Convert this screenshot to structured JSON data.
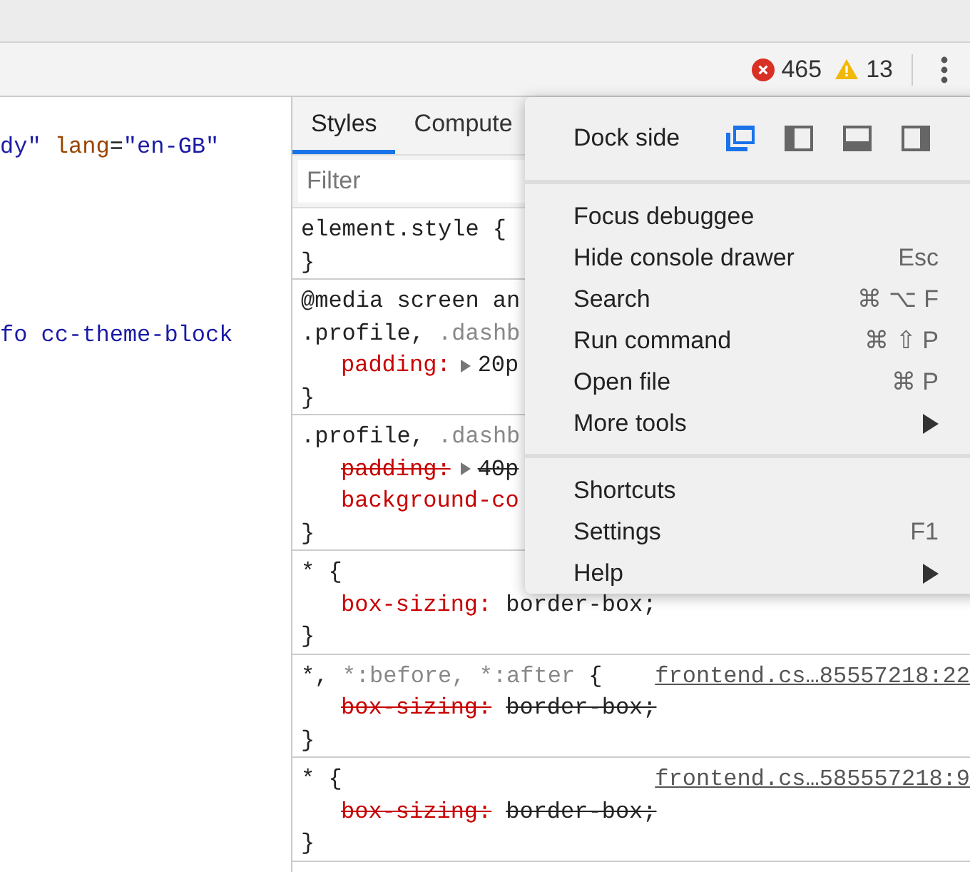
{
  "toolbar": {
    "errors": "465",
    "warnings": "13"
  },
  "elements": {
    "lines": [
      {
        "tokens": [
          {
            "kind": "value",
            "text": "dy\""
          },
          {
            "kind": "name",
            "text": "lang"
          },
          {
            "kind": "punct",
            "text": "="
          },
          {
            "kind": "value",
            "text": "\"en-GB\""
          }
        ]
      },
      {
        "tokens": [
          {
            "kind": "value",
            "text": "fo cc-theme-block"
          }
        ]
      }
    ]
  },
  "styles": {
    "tabs": [
      {
        "label": "Styles",
        "selected": true
      },
      {
        "label": "Compute",
        "selected": false
      }
    ],
    "filter": {
      "placeholder": "Filter"
    },
    "rules": [
      {
        "selector": [
          {
            "text": "element.style {",
            "matched": true
          }
        ],
        "close": "}"
      },
      {
        "selector": [
          {
            "text": "@media screen an",
            "matched": true
          }
        ],
        "selector2": [
          {
            "text": ".profile,",
            "matched": true
          },
          {
            "text": ".dashb",
            "matched": false
          }
        ],
        "properties": [
          {
            "name": "padding:",
            "value": "20p",
            "expandable": true,
            "overridden": false
          }
        ],
        "close": "}"
      },
      {
        "selector": [
          {
            "text": ".profile,",
            "matched": true
          },
          {
            "text": ".dashb",
            "matched": false
          }
        ],
        "properties": [
          {
            "name": "padding:",
            "value": "40p",
            "expandable": true,
            "overridden": true
          },
          {
            "name": "background-co",
            "expandable": false,
            "overridden": false
          }
        ],
        "close": "}"
      },
      {
        "selector": [
          {
            "text": "* {",
            "matched": true
          }
        ],
        "properties": [
          {
            "name": "box-sizing:",
            "value": "border-box;",
            "expandable": false,
            "overridden": false
          }
        ],
        "close": "}"
      },
      {
        "selector": [
          {
            "text": "*,",
            "matched": true
          },
          {
            "text": "*:before,",
            "matched": false
          },
          {
            "text": "*:after",
            "matched": false
          },
          {
            "text": "{",
            "matched": true
          }
        ],
        "source": "frontend.cs…85557218:22",
        "properties": [
          {
            "name": "box-sizing:",
            "value": "border-box;",
            "expandable": false,
            "overridden": true
          }
        ],
        "close": "}"
      },
      {
        "selector": [
          {
            "text": "* {",
            "matched": true
          }
        ],
        "source": "frontend.cs…585557218:9",
        "properties": [
          {
            "name": "box-sizing:",
            "value": "border-box;",
            "expandable": false,
            "overridden": true
          }
        ],
        "close": "}"
      }
    ]
  },
  "menu": {
    "dock_label": "Dock side",
    "dock_options": [
      {
        "kind": "undock",
        "selected": true
      },
      {
        "kind": "left",
        "selected": false
      },
      {
        "kind": "bottom",
        "selected": false
      },
      {
        "kind": "right",
        "selected": false
      }
    ],
    "sections": [
      [
        {
          "label": "Focus debuggee",
          "submenu": false
        },
        {
          "label": "Hide console drawer",
          "shortcut": "Esc",
          "submenu": false
        },
        {
          "label": "Search",
          "shortcut": "⌘ ⌥ F",
          "submenu": false
        },
        {
          "label": "Run command",
          "shortcut": "⌘ ⇧ P",
          "submenu": false
        },
        {
          "label": "Open file",
          "shortcut": "⌘ P",
          "submenu": false
        },
        {
          "label": "More tools",
          "submenu": true
        }
      ],
      [
        {
          "label": "Shortcuts",
          "submenu": false
        },
        {
          "label": "Settings",
          "shortcut": "F1",
          "submenu": false
        },
        {
          "label": "Help",
          "submenu": true
        }
      ]
    ]
  }
}
